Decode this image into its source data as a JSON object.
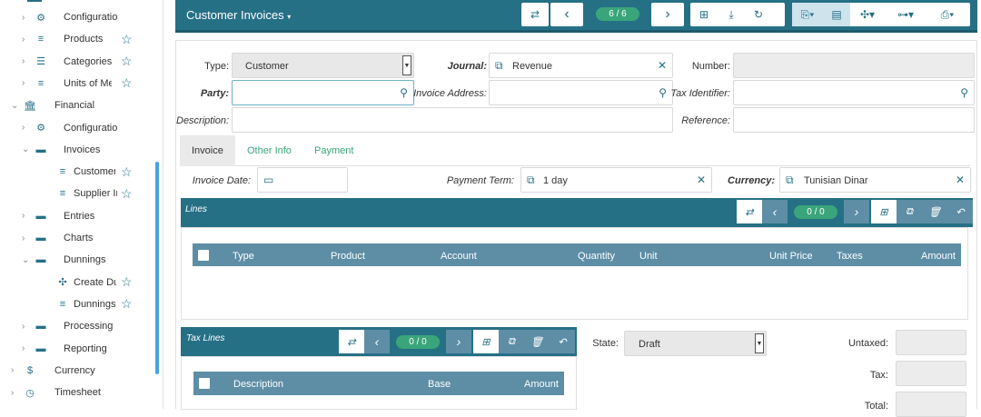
{
  "sidebar": {
    "items": [
      {
        "label": "Configuration",
        "icon": "gear-icon",
        "chev": "›",
        "star": false
      },
      {
        "label": "Products",
        "icon": "list-icon",
        "chev": "›",
        "star": true
      },
      {
        "label": "Categories",
        "icon": "list-bullets-icon",
        "chev": "›",
        "star": true
      },
      {
        "label": "Units of Measure",
        "icon": "list-icon",
        "chev": "›",
        "star": true
      },
      {
        "label": "Financial",
        "icon": "bank-icon",
        "chev": "⌄",
        "star": false
      },
      {
        "label": "Configuration",
        "icon": "gear-icon",
        "chev": "›",
        "star": false
      },
      {
        "label": "Invoices",
        "icon": "folder-icon",
        "chev": "⌄",
        "star": false
      },
      {
        "label": "Customer Invoices",
        "icon": "list-icon",
        "chev": "",
        "star": true
      },
      {
        "label": "Supplier Invoices",
        "icon": "list-icon",
        "chev": "",
        "star": true
      },
      {
        "label": "Entries",
        "icon": "folder-icon",
        "chev": "›",
        "star": false
      },
      {
        "label": "Charts",
        "icon": "folder-icon",
        "chev": "›",
        "star": false
      },
      {
        "label": "Dunnings",
        "icon": "folder-icon",
        "chev": "⌄",
        "star": false
      },
      {
        "label": "Create Dunnings",
        "icon": "wizard-icon",
        "chev": "",
        "star": true
      },
      {
        "label": "Dunnings",
        "icon": "list-icon",
        "chev": "",
        "star": true
      },
      {
        "label": "Processing",
        "icon": "folder-icon",
        "chev": "›",
        "star": false
      },
      {
        "label": "Reporting",
        "icon": "folder-icon",
        "chev": "›",
        "star": false
      },
      {
        "label": "Currency",
        "icon": "dollar-icon",
        "chev": "›",
        "star": false
      },
      {
        "label": "Timesheet",
        "icon": "clock-icon",
        "chev": "›",
        "star": false
      }
    ]
  },
  "header": {
    "title": "Customer Invoices",
    "record_counter": "6 / 6"
  },
  "form": {
    "type_label": "Type:",
    "type_value": "Customer",
    "journal_label": "Journal:",
    "journal_value": "Revenue",
    "number_label": "Number:",
    "party_label": "Party:",
    "invoice_address_label": "Invoice Address:",
    "tax_identifier_label": "Tax Identifier:",
    "description_label": "Description:",
    "reference_label": "Reference:"
  },
  "tabs": [
    "Invoice",
    "Other Info",
    "Payment"
  ],
  "invoice_tab": {
    "invoice_date_label": "Invoice Date:",
    "payment_term_label": "Payment Term:",
    "payment_term_value": "1 day",
    "currency_label": "Currency:",
    "currency_value": "Tunisian Dinar"
  },
  "lines": {
    "title": "Lines",
    "counter": "0 / 0",
    "columns": [
      "Type",
      "Product",
      "Account",
      "Quantity",
      "Unit",
      "Unit Price",
      "Taxes",
      "Amount"
    ]
  },
  "tax_lines": {
    "title": "Tax Lines",
    "counter": "0 / 0",
    "columns": [
      "Description",
      "Base",
      "Amount"
    ]
  },
  "totals": {
    "state_label": "State:",
    "state_value": "Draft",
    "untaxed_label": "Untaxed:",
    "tax_label": "Tax:",
    "total_label": "Total:"
  }
}
